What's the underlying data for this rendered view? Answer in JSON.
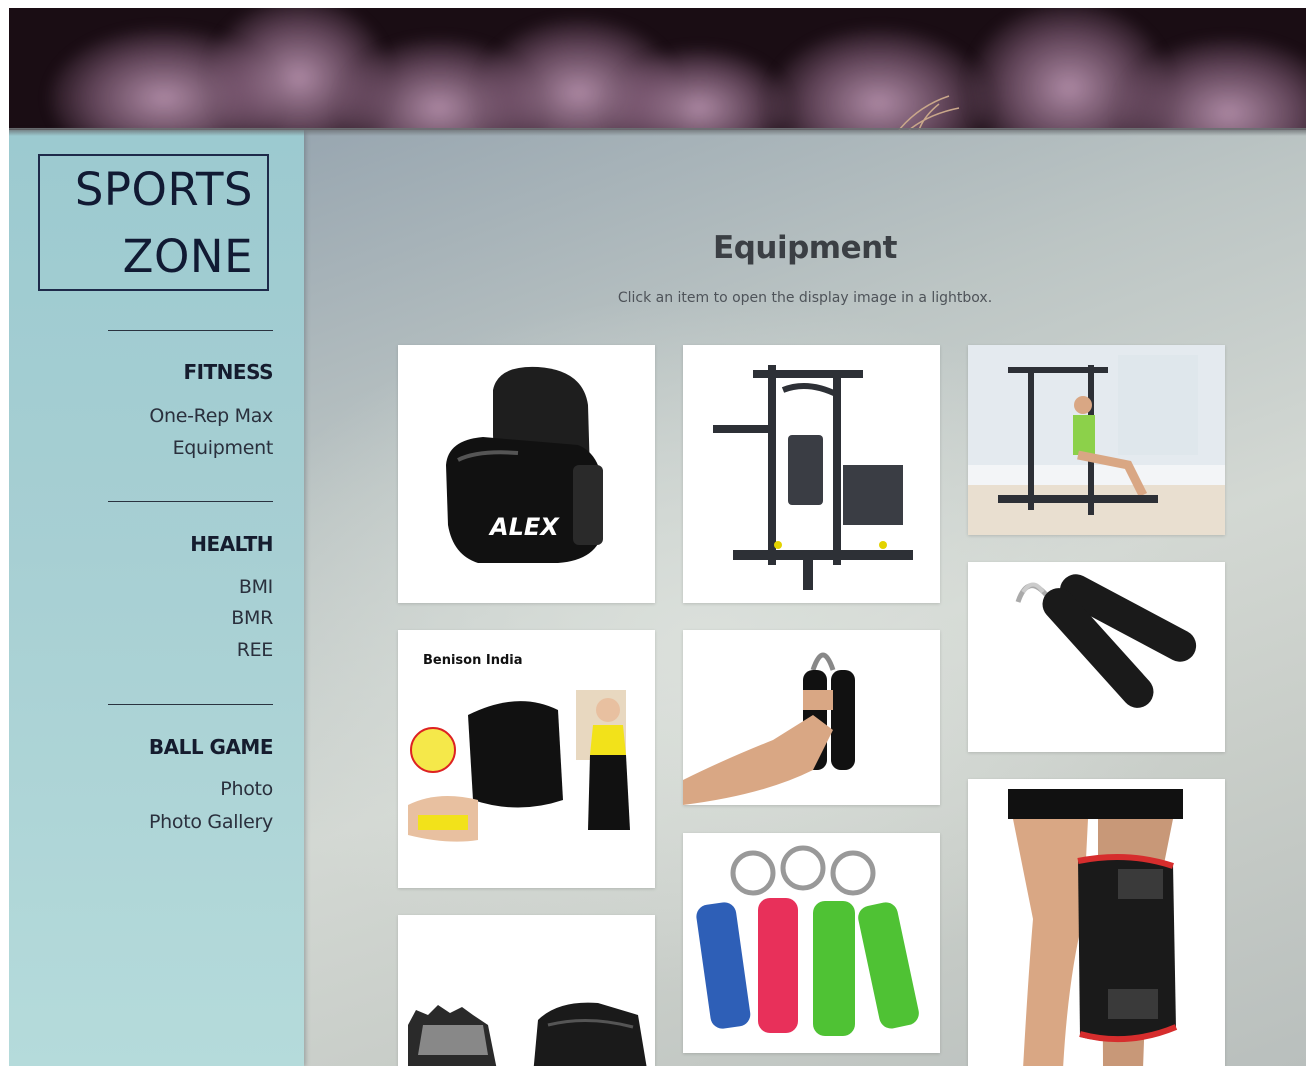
{
  "logo": {
    "line1": "SPORTS",
    "line2": "ZONE"
  },
  "nav": {
    "sections": [
      {
        "heading": "FITNESS",
        "links": [
          "One-Rep Max",
          "Equipment"
        ]
      },
      {
        "heading": "HEALTH",
        "links": [
          "BMI",
          "BMR",
          "REE"
        ]
      },
      {
        "heading": "BALL GAME",
        "links": [
          "Photo",
          "Photo Gallery"
        ]
      }
    ]
  },
  "main": {
    "title": "Equipment",
    "subtitle": "Click an item to open the display image in a lightbox.",
    "gallery": [
      {
        "name": "boxing-glove-image",
        "brand": "ALEX"
      },
      {
        "name": "home-gym-machine-image"
      },
      {
        "name": "home-gym-with-person-image"
      },
      {
        "name": "slimming-belt-image",
        "brand": "Benison India"
      },
      {
        "name": "hand-grip-in-hand-image"
      },
      {
        "name": "hand-grip-pair-image"
      },
      {
        "name": "fitness-gloves-image"
      },
      {
        "name": "colored-hand-grips-image"
      },
      {
        "name": "knee-support-image"
      }
    ]
  },
  "colors": {
    "sidebar": "#a7cfd3",
    "banner": "#1a0d14",
    "logo_text": "#111a33",
    "title_text": "#3b3f44"
  }
}
